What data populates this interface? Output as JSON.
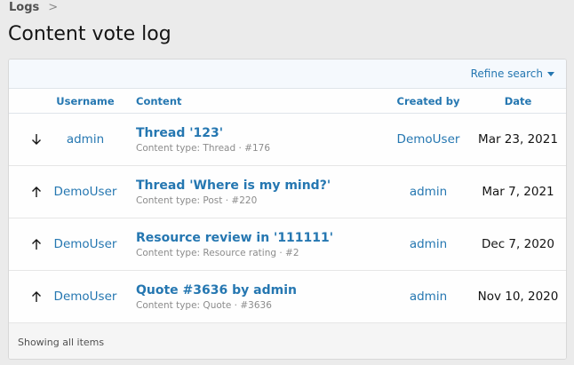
{
  "breadcrumb": {
    "items": [
      "Logs"
    ],
    "separator": ">"
  },
  "page": {
    "title": "Content vote log"
  },
  "filter": {
    "refine_label": "Refine search"
  },
  "table": {
    "headers": {
      "username": "Username",
      "content": "Content",
      "created_by": "Created by",
      "date": "Date"
    },
    "rows": [
      {
        "direction": "down",
        "username": "admin",
        "title": "Thread '123'",
        "meta": "Content type: Thread · #176",
        "created_by": "DemoUser",
        "date": "Mar 23, 2021"
      },
      {
        "direction": "up",
        "username": "DemoUser",
        "title": "Thread 'Where is my mind?'",
        "meta": "Content type: Post · #220",
        "created_by": "admin",
        "date": "Mar 7, 2021"
      },
      {
        "direction": "up",
        "username": "DemoUser",
        "title": "Resource review in '111111'",
        "meta": "Content type: Resource rating · #2",
        "created_by": "admin",
        "date": "Dec 7, 2020"
      },
      {
        "direction": "up",
        "username": "DemoUser",
        "title": "Quote #3636 by admin",
        "meta": "Content type: Quote · #3636",
        "created_by": "admin",
        "date": "Nov 10, 2020"
      }
    ]
  },
  "footer": {
    "text": "Showing all items"
  },
  "colors": {
    "link": "#2577b1",
    "text": "#141414",
    "muted": "#8c8c8c",
    "background": "#ebebeb"
  }
}
